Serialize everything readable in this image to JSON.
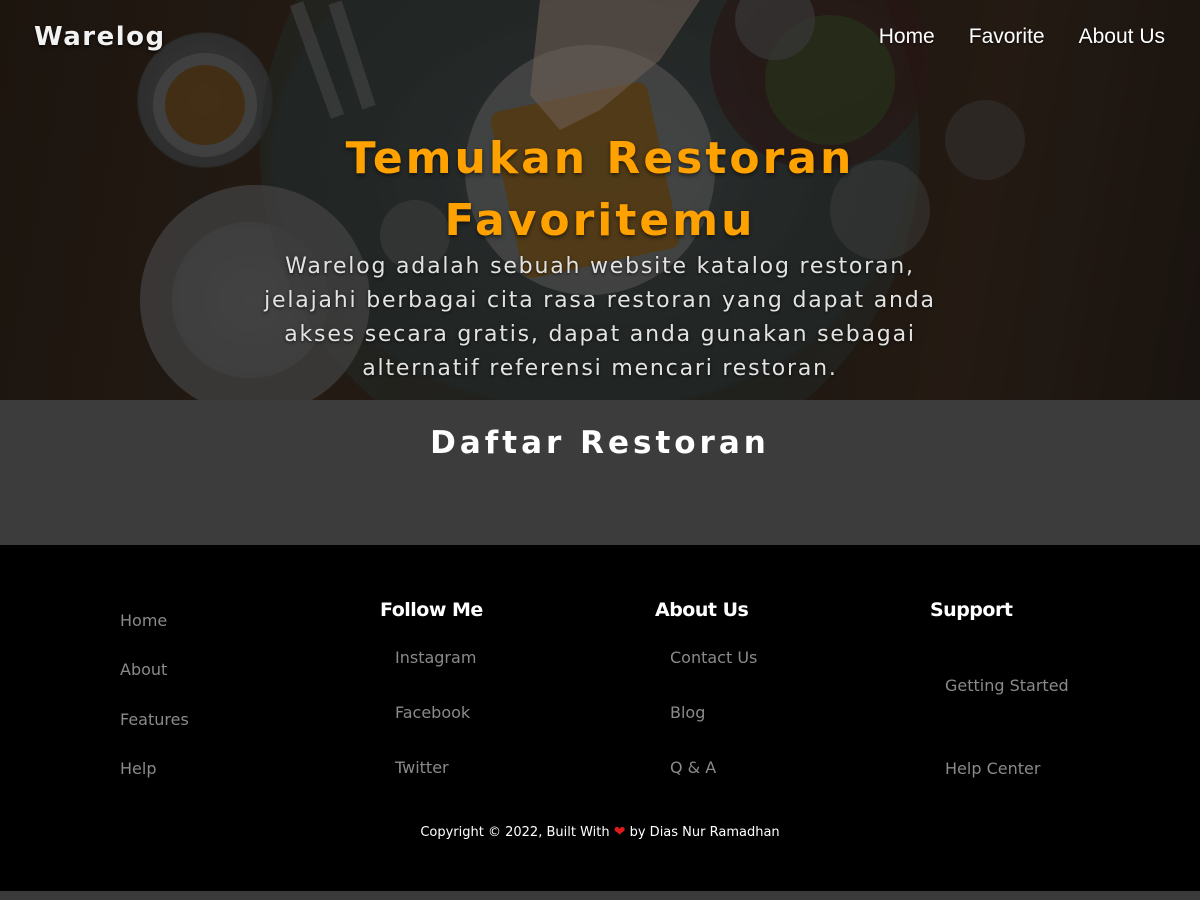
{
  "header": {
    "brand": "Warelog",
    "nav": [
      {
        "label": "Home"
      },
      {
        "label": "Favorite"
      },
      {
        "label": "About Us"
      }
    ]
  },
  "hero": {
    "title": "Temukan Restoran Favoritemu",
    "description": "Warelog adalah sebuah website katalog restoran, jelajahi berbagai cita rasa restoran yang dapat anda akses secara gratis, dapat anda gunakan sebagai alternatif referensi mencari restoran.",
    "title_color": "#ffa200"
  },
  "list_section": {
    "title": "Daftar Restoran"
  },
  "footer": {
    "col1": {
      "links": [
        "Home",
        "About",
        "Features",
        "Help"
      ]
    },
    "col2": {
      "heading": "Follow Me",
      "links": [
        "Instagram",
        "Facebook",
        "Twitter"
      ]
    },
    "col3": {
      "heading": "About Us",
      "links": [
        "Contact Us",
        "Blog",
        "Q & A"
      ]
    },
    "col4": {
      "heading": "Support",
      "links": [
        "Getting Started",
        "Help Center"
      ]
    },
    "copyright_before": "Copyright © 2022, Built With",
    "copyright_after": "by Dias Nur Ramadhan",
    "heart_icon": "heart-icon",
    "heart_glyph": "❤"
  }
}
